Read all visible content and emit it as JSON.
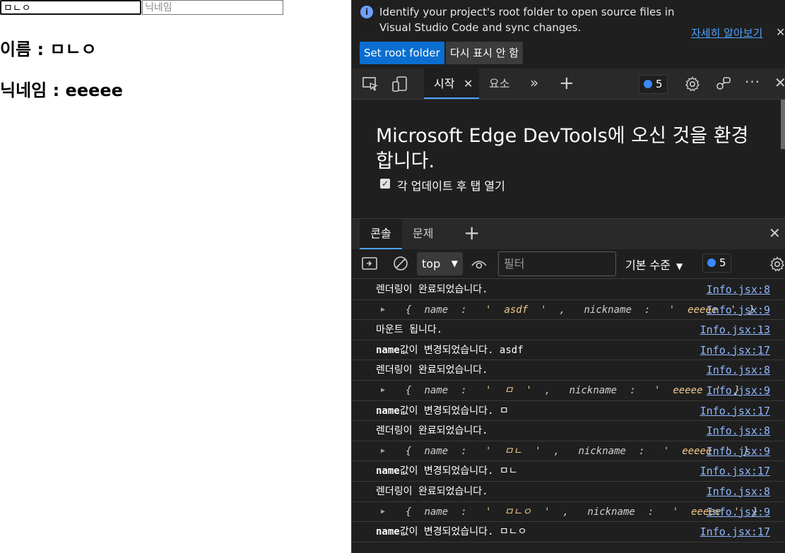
{
  "page": {
    "name_input_value": "ㅁㄴㅇ",
    "nickname_placeholder": "닉네임",
    "name_line": "이름 : ㅁㄴㅇ",
    "nickname_line": "닉네임 : eeeee"
  },
  "devtools": {
    "infobar": {
      "text": "Identify your project's root folder to open source files in Visual Studio Code and sync changes.",
      "learn_more": "자세히 알아보기",
      "primary_button": "Set root folder",
      "secondary_button": "다시 표시 안 함"
    },
    "toolbar": {
      "tabs": [
        {
          "label": "시작",
          "active": true
        },
        {
          "label": "요소",
          "active": false
        }
      ],
      "issues_count": "5"
    },
    "welcome": {
      "title": "Microsoft Edge DevTools에 오신 것을 환경합니다.",
      "checkbox_label": "각 업데이트 후 탭 열기",
      "checked": true
    },
    "drawer": {
      "tabs": [
        {
          "label": "콘솔",
          "active": true
        },
        {
          "label": "문제",
          "active": false
        }
      ]
    },
    "console_toolbar": {
      "context": "top",
      "filter_placeholder": "필터",
      "levels": "기본 수준",
      "issues_count": "5"
    },
    "console": {
      "rows": [
        {
          "type": "text",
          "text": "렌더링이 완료되었습니다.",
          "source": "Info.jsx:8"
        },
        {
          "type": "object",
          "name": "asdf",
          "nickname": "eeeee",
          "source": "Info.jsx:9"
        },
        {
          "type": "text",
          "text": "마운트 됩니다.",
          "source": "Info.jsx:13"
        },
        {
          "type": "text",
          "text": "name값이 변경되었습니다. asdf",
          "source": "Info.jsx:17"
        },
        {
          "type": "text",
          "text": "렌더링이 완료되었습니다.",
          "source": "Info.jsx:8"
        },
        {
          "type": "object",
          "name": "ㅁ",
          "nickname": "eeeee",
          "source": "Info.jsx:9"
        },
        {
          "type": "text",
          "text": "name값이 변경되었습니다. ㅁ",
          "source": "Info.jsx:17"
        },
        {
          "type": "text",
          "text": "렌더링이 완료되었습니다.",
          "source": "Info.jsx:8"
        },
        {
          "type": "object",
          "name": "ㅁㄴ",
          "nickname": "eeeee",
          "source": "Info.jsx:9"
        },
        {
          "type": "text",
          "text": "name값이 변경되었습니다. ㅁㄴ",
          "source": "Info.jsx:17"
        },
        {
          "type": "text",
          "text": "렌더링이 완료되었습니다.",
          "source": "Info.jsx:8"
        },
        {
          "type": "object",
          "name": "ㅁㄴㅇ",
          "nickname": "eeeee",
          "source": "Info.jsx:9"
        },
        {
          "type": "text",
          "text": "name값이 변경되었습니다. ㅁㄴㅇ",
          "source": "Info.jsx:17"
        }
      ]
    },
    "colors": {
      "accent": "#4da3ff",
      "primary_button": "#0a6ed1",
      "background": "#1f1f1f"
    }
  }
}
